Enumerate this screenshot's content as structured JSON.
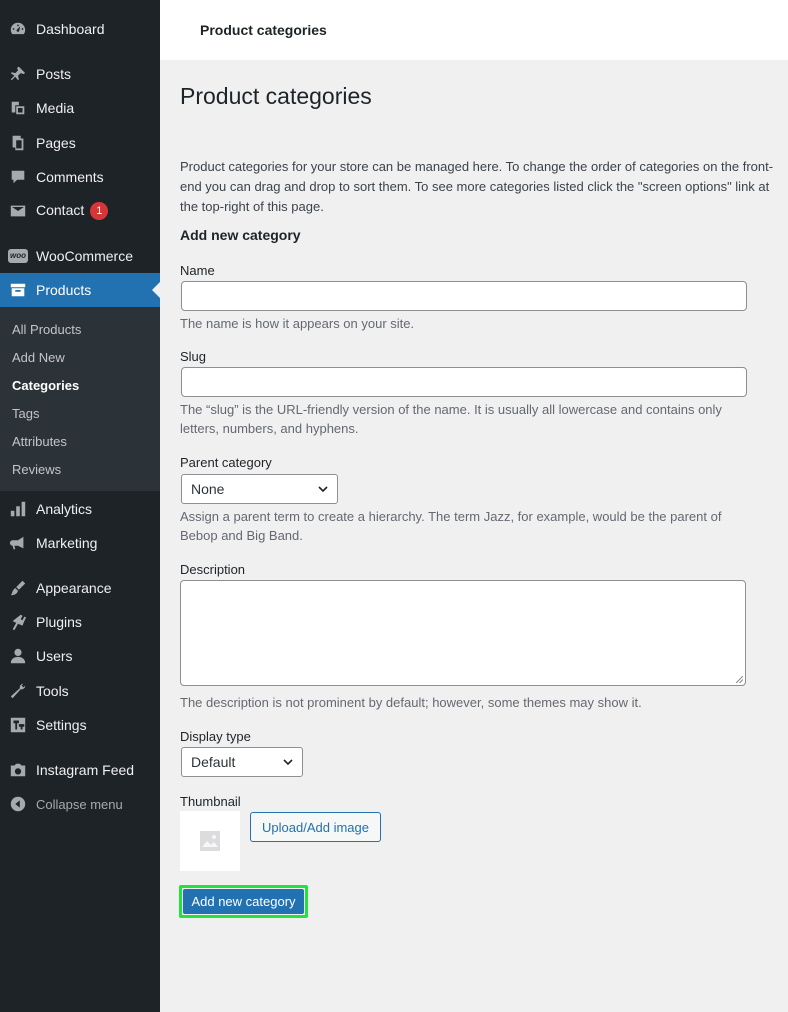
{
  "sidebar": {
    "items": [
      {
        "label": "Dashboard",
        "icon": "dashboard-icon"
      },
      {
        "label": "Posts",
        "icon": "pin-icon"
      },
      {
        "label": "Media",
        "icon": "media-icon"
      },
      {
        "label": "Pages",
        "icon": "pages-icon"
      },
      {
        "label": "Comments",
        "icon": "comment-icon"
      },
      {
        "label": "Contact",
        "icon": "envelope-icon",
        "badge": "1"
      },
      {
        "label": "WooCommerce",
        "icon": "woo-icon",
        "icon_text": "woo"
      },
      {
        "label": "Products",
        "icon": "archive-icon"
      },
      {
        "label": "Analytics",
        "icon": "bar-chart-icon"
      },
      {
        "label": "Marketing",
        "icon": "megaphone-icon"
      },
      {
        "label": "Appearance",
        "icon": "brush-icon"
      },
      {
        "label": "Plugins",
        "icon": "plug-icon"
      },
      {
        "label": "Users",
        "icon": "user-icon"
      },
      {
        "label": "Tools",
        "icon": "wrench-icon"
      },
      {
        "label": "Settings",
        "icon": "settings-icon"
      },
      {
        "label": "Instagram Feed",
        "icon": "camera-icon"
      },
      {
        "label": "Collapse menu",
        "icon": "collapse-icon"
      }
    ],
    "submenu": [
      "All Products",
      "Add New",
      "Categories",
      "Tags",
      "Attributes",
      "Reviews"
    ],
    "current_item": "Products",
    "current_sub": "Categories"
  },
  "topbar": {
    "breadcrumb": "Product categories"
  },
  "main": {
    "title": "Product categories",
    "intro": "Product categories for your store can be managed here. To change the order of categories on the front-end you can drag and drop to sort them. To see more categories listed click the \"screen options\" link at the top-right of this page.",
    "section_heading": "Add new category",
    "name_label": "Name",
    "name_value": "",
    "name_help": "The name is how it appears on your site.",
    "slug_label": "Slug",
    "slug_value": "",
    "slug_help": "The “slug” is the URL-friendly version of the name. It is usually all lowercase and contains only letters, numbers, and hyphens.",
    "parent_label": "Parent category",
    "parent_value": "None",
    "parent_help": "Assign a parent term to create a hierarchy. The term Jazz, for example, would be the parent of Bebop and Big Band.",
    "description_label": "Description",
    "description_help": "The description is not prominent by default; however, some themes may show it.",
    "display_label": "Display type",
    "display_value": "Default",
    "thumbnail_label": "Thumbnail",
    "upload_label": "Upload/Add image",
    "submit_label": "Add new category"
  },
  "colors": {
    "sidebar_bg": "#1d2327",
    "accent": "#2271b1",
    "badge": "#d63638",
    "highlight": "#22e33b"
  }
}
